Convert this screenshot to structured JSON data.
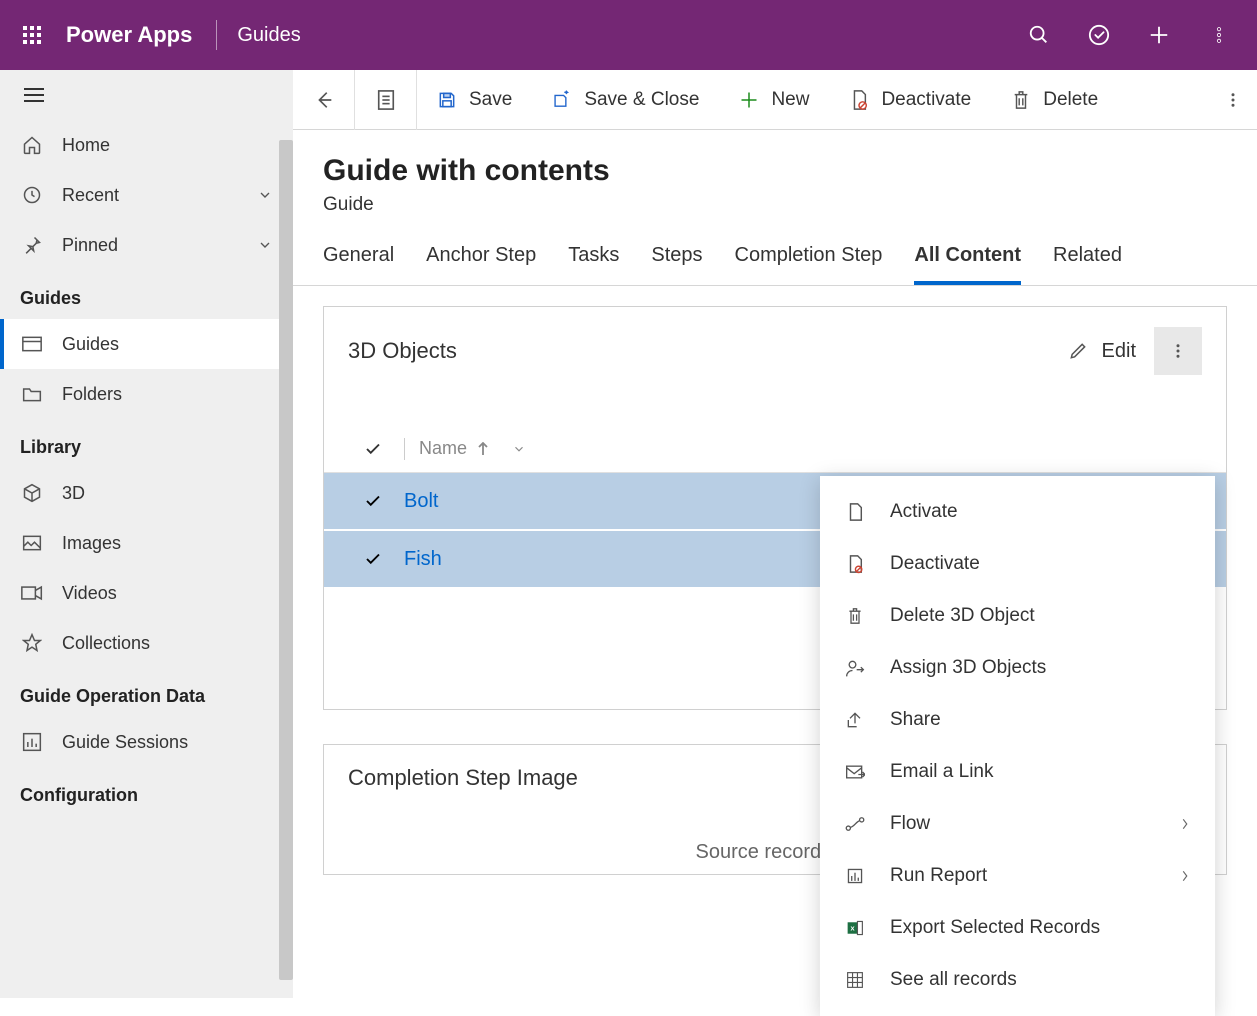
{
  "header": {
    "app_title": "Power Apps",
    "module": "Guides"
  },
  "sidebar": {
    "nav": [
      "Home",
      "Recent",
      "Pinned"
    ],
    "section_guides": "Guides",
    "guides_items": [
      "Guides",
      "Folders"
    ],
    "section_library": "Library",
    "library_items": [
      "3D",
      "Images",
      "Videos",
      "Collections"
    ],
    "section_guide_op": "Guide Operation Data",
    "guide_op_items": [
      "Guide Sessions"
    ],
    "section_config": "Configuration"
  },
  "cmdbar": {
    "save": "Save",
    "save_close": "Save & Close",
    "new": "New",
    "deactivate": "Deactivate",
    "delete": "Delete"
  },
  "record": {
    "title": "Guide with contents",
    "entity": "Guide"
  },
  "tabs": [
    "General",
    "Anchor Step",
    "Tasks",
    "Steps",
    "Completion Step",
    "All Content",
    "Related"
  ],
  "active_tab": "All Content",
  "panel_3d": {
    "title": "3D Objects",
    "edit": "Edit",
    "col_name": "Name",
    "rows": [
      "Bolt",
      "Fish"
    ]
  },
  "panel_completion": {
    "title": "Completion Step Image",
    "msg": "Source record not"
  },
  "ctx": {
    "items": [
      "Activate",
      "Deactivate",
      "Delete 3D Object",
      "Assign 3D Objects",
      "Share",
      "Email a Link",
      "Flow",
      "Run Report",
      "Export Selected Records",
      "See all records"
    ]
  }
}
